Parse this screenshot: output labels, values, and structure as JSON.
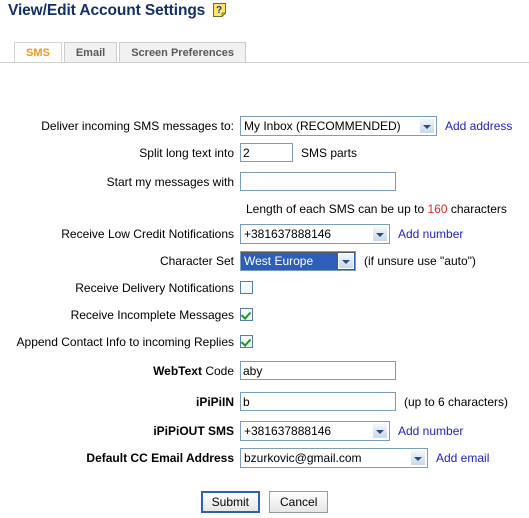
{
  "page": {
    "title": "View/Edit Account Settings",
    "help_icon": "help-question-icon"
  },
  "tabs": [
    {
      "label": "SMS",
      "active": true
    },
    {
      "label": "Email",
      "active": false
    },
    {
      "label": "Screen Preferences",
      "active": false
    }
  ],
  "form": {
    "deliver_to": {
      "label": "Deliver incoming SMS messages to:",
      "value": "My Inbox (RECOMMENDED)",
      "link": "Add address"
    },
    "split_parts": {
      "label": "Split long text into",
      "value": "2",
      "suffix": "SMS parts"
    },
    "start_with": {
      "label": "Start my messages with",
      "value": "",
      "placeholder": ""
    },
    "length_hint": {
      "prefix": "Length of each SMS can be up to",
      "number": "160",
      "suffix": "characters",
      "number_color": "#e8252b"
    },
    "low_credit": {
      "label": "Receive Low Credit Notifications",
      "value": "+381637888146",
      "link": "Add number"
    },
    "character_set": {
      "label": "Character Set",
      "value": "West Europe",
      "note": "(if unsure use \"auto\")",
      "focused": true
    },
    "delivery_notifications": {
      "label": "Receive Delivery Notifications",
      "checked": false
    },
    "incomplete_messages": {
      "label": "Receive Incomplete Messages",
      "checked": true
    },
    "append_contact_info": {
      "label": "Append Contact Info to incoming Replies",
      "checked": true
    },
    "webtext_code": {
      "label_bold": "WebText",
      "label_rest": "Code",
      "value": "aby"
    },
    "ipipiin": {
      "label": "iPiPiIN",
      "value": "b",
      "note": "(up to 6 characters)"
    },
    "ipipiout_sms": {
      "label": "iPiPiOUT SMS",
      "value": "+381637888146",
      "link": "Add number"
    },
    "default_cc_email": {
      "label": "Default CC Email Address",
      "value": "bzurkovic@gmail.com",
      "link": "Add email"
    }
  },
  "buttons": {
    "submit": "Submit",
    "cancel": "Cancel"
  }
}
